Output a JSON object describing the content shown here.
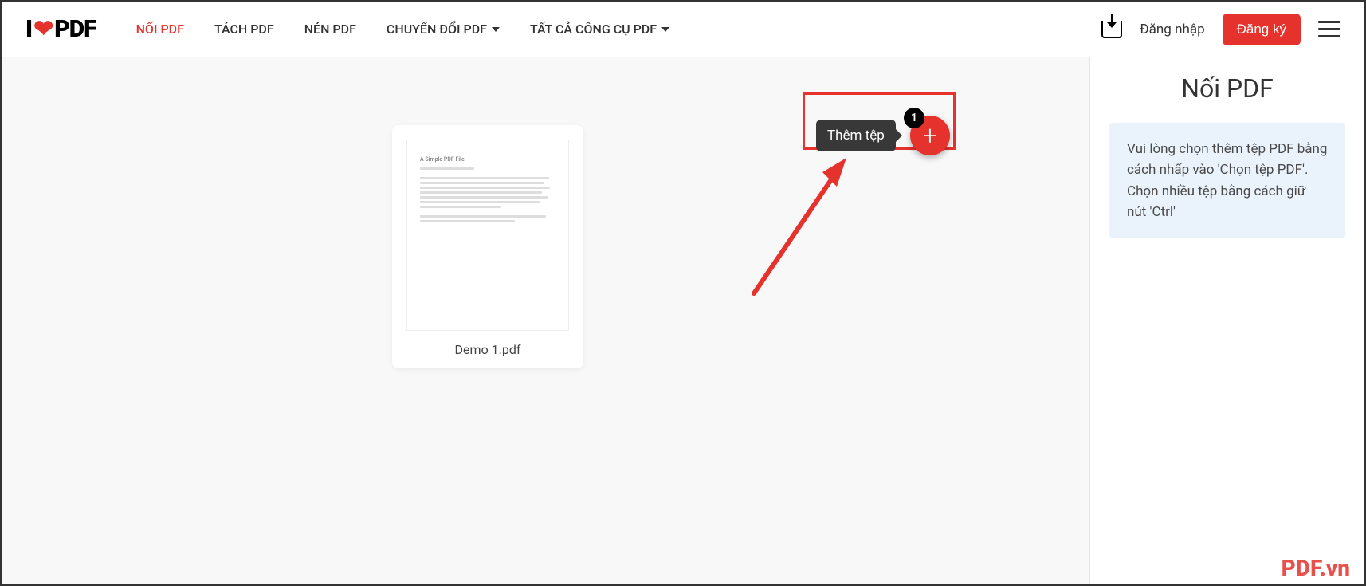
{
  "header": {
    "logo_prefix": "I",
    "logo_suffix": "PDF",
    "nav": {
      "merge": "NỐI PDF",
      "split": "TÁCH PDF",
      "compress": "NÉN PDF",
      "convert": "CHUYỂN ĐỔI PDF",
      "all_tools": "TẤT CẢ CÔNG CỤ PDF"
    },
    "login": "Đăng nhập",
    "signup": "Đăng ký"
  },
  "workspace": {
    "file_name": "Demo 1.pdf",
    "preview_title": "A Simple PDF File",
    "tooltip_add": "Thêm tệp",
    "fab_badge": "1"
  },
  "sidebar": {
    "title": "Nối PDF",
    "info_line1": "Vui lòng chọn thêm tệp PDF bằng cách nhấp vào 'Chọn tệp PDF'.",
    "info_line2": "Chọn nhiều tệp bằng cách giữ nút 'Ctrl'"
  },
  "watermark": "PDF.vn"
}
